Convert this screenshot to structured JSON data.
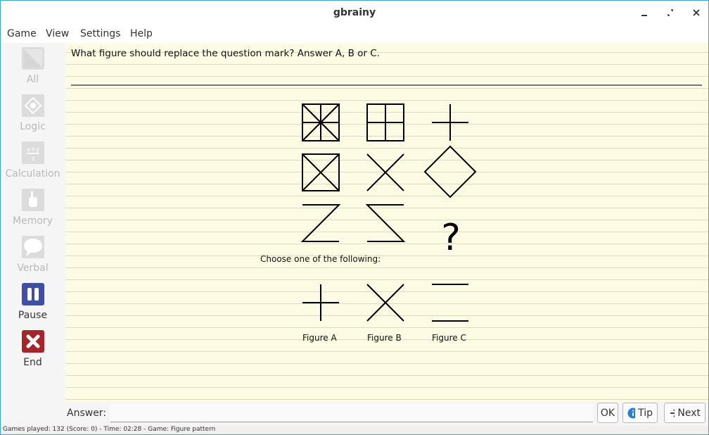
{
  "window": {
    "title": "gbrainy"
  },
  "menu": [
    "Game",
    "View",
    "Settings",
    "Help"
  ],
  "sidebar": [
    {
      "label": "All",
      "icon": "all-games-icon",
      "enabled": false
    },
    {
      "label": "Logic",
      "icon": "logic-icon",
      "enabled": false
    },
    {
      "label": "Calculation",
      "icon": "calculation-icon",
      "enabled": false
    },
    {
      "label": "Memory",
      "icon": "memory-icon",
      "enabled": false
    },
    {
      "label": "Verbal",
      "icon": "verbal-icon",
      "enabled": false
    },
    {
      "label": "Pause",
      "icon": "pause-icon",
      "enabled": true,
      "color": "#3f4fa5"
    },
    {
      "label": "End",
      "icon": "end-icon",
      "enabled": true,
      "color": "#a5252b"
    }
  ],
  "puzzle": {
    "question": "What figure should replace the question mark? Answer A, B or C.",
    "unknown_mark": "?",
    "choose_text": "Choose one of the following:",
    "options": [
      "Figure A",
      "Figure B",
      "Figure C"
    ]
  },
  "answer": {
    "label": "Answer:",
    "value": "",
    "placeholder": ""
  },
  "buttons": {
    "ok": "OK",
    "tip": "Tip",
    "next": "Next"
  },
  "status": "Games played: 132 (Score: 0) - Time: 02:28 - Game: Figure pattern",
  "colors": {
    "paper": "#fdfbe4",
    "accent_border": "#3aa8c6",
    "tip_icon": "#2a7fd4"
  }
}
